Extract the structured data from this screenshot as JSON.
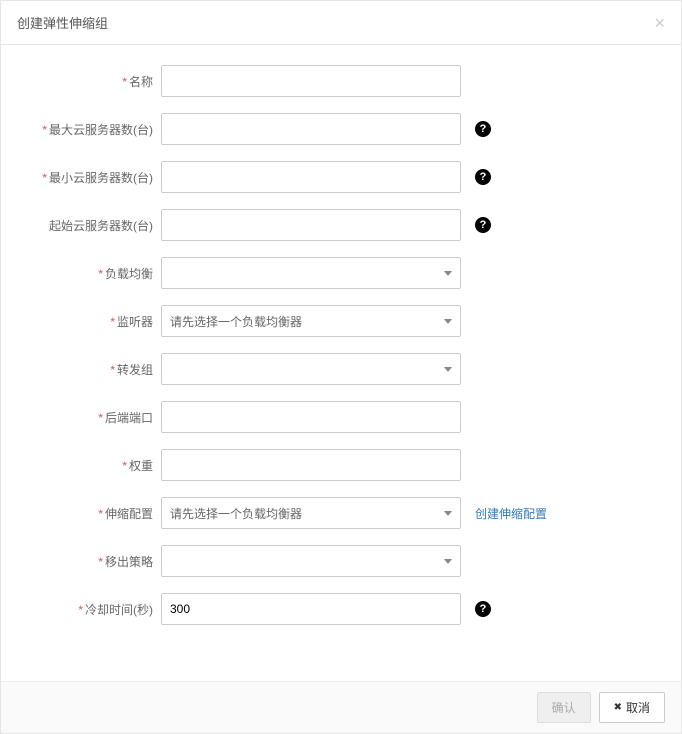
{
  "modal": {
    "title": "创建弹性伸缩组",
    "close_symbol": "×"
  },
  "form": {
    "name": {
      "label": "名称",
      "required": true,
      "value": ""
    },
    "max_servers": {
      "label": "最大云服务器数(台)",
      "required": true,
      "value": ""
    },
    "min_servers": {
      "label": "最小云服务器数(台)",
      "required": true,
      "value": ""
    },
    "initial_servers": {
      "label": "起始云服务器数(台)",
      "required": false,
      "value": ""
    },
    "load_balancer": {
      "label": "负载均衡",
      "required": true,
      "placeholder": ""
    },
    "listener": {
      "label": "监听器",
      "required": true,
      "placeholder": "请先选择一个负载均衡器"
    },
    "forward_group": {
      "label": "转发组",
      "required": true,
      "placeholder": ""
    },
    "backend_port": {
      "label": "后端端口",
      "required": true,
      "value": ""
    },
    "weight": {
      "label": "权重",
      "required": true,
      "value": ""
    },
    "scaling_config": {
      "label": "伸缩配置",
      "required": true,
      "placeholder": "请先选择一个负载均衡器",
      "action_link": "创建伸缩配置"
    },
    "removal_policy": {
      "label": "移出策略",
      "required": true,
      "placeholder": ""
    },
    "cooldown": {
      "label": "冷却时间(秒)",
      "required": true,
      "value": "300"
    }
  },
  "footer": {
    "confirm": "确认",
    "cancel": "取消"
  },
  "help_symbol": "?"
}
